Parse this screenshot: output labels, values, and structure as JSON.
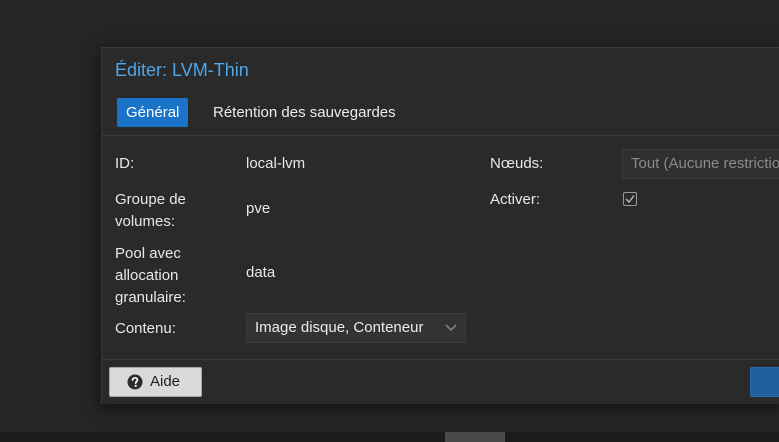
{
  "dialog": {
    "title": "Éditer: LVM-Thin"
  },
  "tabs": [
    {
      "label": "Général",
      "active": true
    },
    {
      "label": "Rétention des sauvegardes",
      "active": false
    }
  ],
  "form": {
    "id_label": "ID:",
    "id_value": "local-lvm",
    "vg_label": "Groupe de volumes:",
    "vg_value": "pve",
    "pool_label": "Pool avec allocation granulaire:",
    "pool_value": "data",
    "content_label": "Contenu:",
    "content_value": "Image disque, Conteneur",
    "nodes_label": "Nœuds:",
    "nodes_value": "Tout (Aucune restriction)",
    "enable_label": "Activer:",
    "enable_checked": true
  },
  "footer": {
    "help_label": "Aide"
  },
  "icons": {
    "help": "question-circle-icon",
    "checkbox": "checkmark-icon",
    "dropdown": "chevron-down-icon"
  },
  "colors": {
    "accent": "#4ea6ea",
    "tab_active_bg": "#1873c9",
    "dialog_bg": "#2a2a2a",
    "page_bg": "#252525"
  }
}
